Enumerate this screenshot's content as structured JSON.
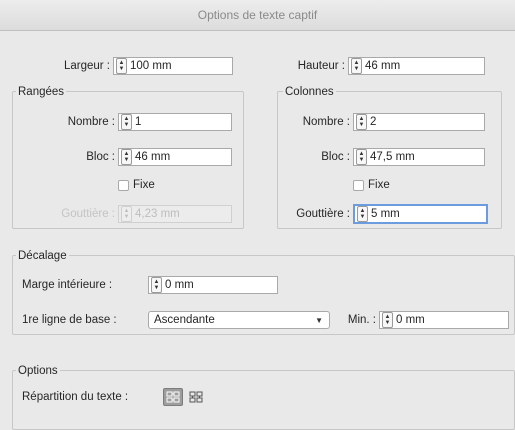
{
  "dialog": {
    "title": "Options de texte captif"
  },
  "size": {
    "width_label": "Largeur :",
    "width_value": "100 mm",
    "height_label": "Hauteur :",
    "height_value": "46 mm"
  },
  "rows": {
    "title": "Rangées",
    "number_label": "Nombre :",
    "number_value": "1",
    "block_label": "Bloc :",
    "block_value": "46 mm",
    "fixed_label": "Fixe",
    "gutter_label": "Gouttière :",
    "gutter_value": "4,23 mm"
  },
  "columns": {
    "title": "Colonnes",
    "number_label": "Nombre :",
    "number_value": "2",
    "block_label": "Bloc :",
    "block_value": "47,5 mm",
    "fixed_label": "Fixe",
    "gutter_label": "Gouttière :",
    "gutter_value": "5 mm"
  },
  "offset": {
    "title": "Décalage",
    "inner_margin_label": "Marge intérieure :",
    "inner_margin_value": "0 mm",
    "baseline_label": "1re ligne de base :",
    "baseline_value": "Ascendante",
    "min_label": "Min. :",
    "min_value": "0 mm"
  },
  "options": {
    "title": "Options",
    "distribution_label": "Répartition du texte :"
  },
  "icons": {
    "stepper": "up-down-stepper-icon",
    "dropdown": "chevron-down-icon",
    "distribution_rows": "text-flow-by-rows-icon",
    "distribution_columns": "text-flow-by-columns-icon"
  }
}
